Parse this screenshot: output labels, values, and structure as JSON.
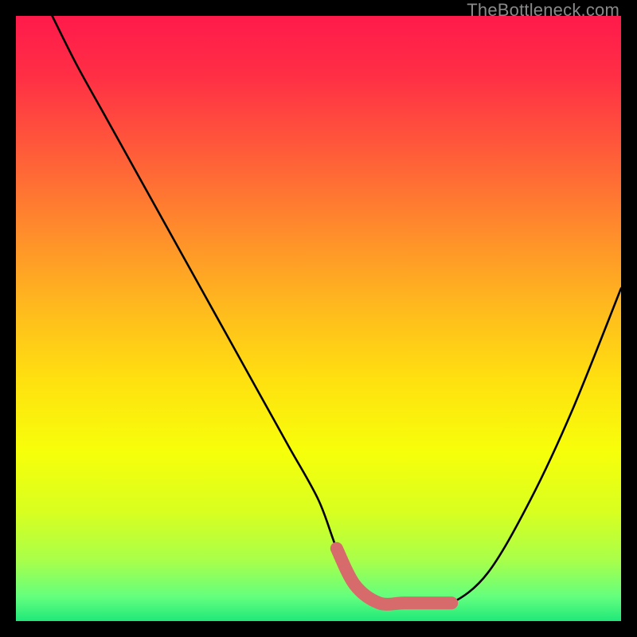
{
  "watermark": "TheBottleneck.com",
  "colors": {
    "gradient_stops": [
      {
        "offset": 0.0,
        "color": "#ff1a4b"
      },
      {
        "offset": 0.1,
        "color": "#ff2f45"
      },
      {
        "offset": 0.22,
        "color": "#ff5a3a"
      },
      {
        "offset": 0.35,
        "color": "#ff8a2c"
      },
      {
        "offset": 0.48,
        "color": "#ffb91e"
      },
      {
        "offset": 0.6,
        "color": "#ffe010"
      },
      {
        "offset": 0.72,
        "color": "#f7ff0a"
      },
      {
        "offset": 0.82,
        "color": "#d8ff20"
      },
      {
        "offset": 0.9,
        "color": "#a8ff4a"
      },
      {
        "offset": 0.96,
        "color": "#63ff7e"
      },
      {
        "offset": 1.0,
        "color": "#20e87a"
      }
    ],
    "curve": "#000000",
    "highlight": "#d76b6b",
    "background": "#000000"
  },
  "chart_data": {
    "type": "line",
    "title": "",
    "xlabel": "",
    "ylabel": "",
    "xlim": [
      0,
      100
    ],
    "ylim": [
      0,
      100
    ],
    "series": [
      {
        "name": "bottleneck-curve",
        "x": [
          6,
          10,
          15,
          20,
          25,
          30,
          35,
          40,
          45,
          50,
          53,
          56,
          60,
          64,
          68,
          72,
          78,
          85,
          92,
          100
        ],
        "values": [
          100,
          92,
          83,
          74,
          65,
          56,
          47,
          38,
          29,
          20,
          12,
          6,
          3,
          3,
          3,
          3,
          8,
          20,
          35,
          55
        ]
      }
    ],
    "highlight_segment": {
      "series": "bottleneck-curve",
      "x": [
        53,
        56,
        60,
        64,
        68,
        72
      ],
      "values": [
        12,
        6,
        3,
        3,
        3,
        3
      ]
    }
  }
}
